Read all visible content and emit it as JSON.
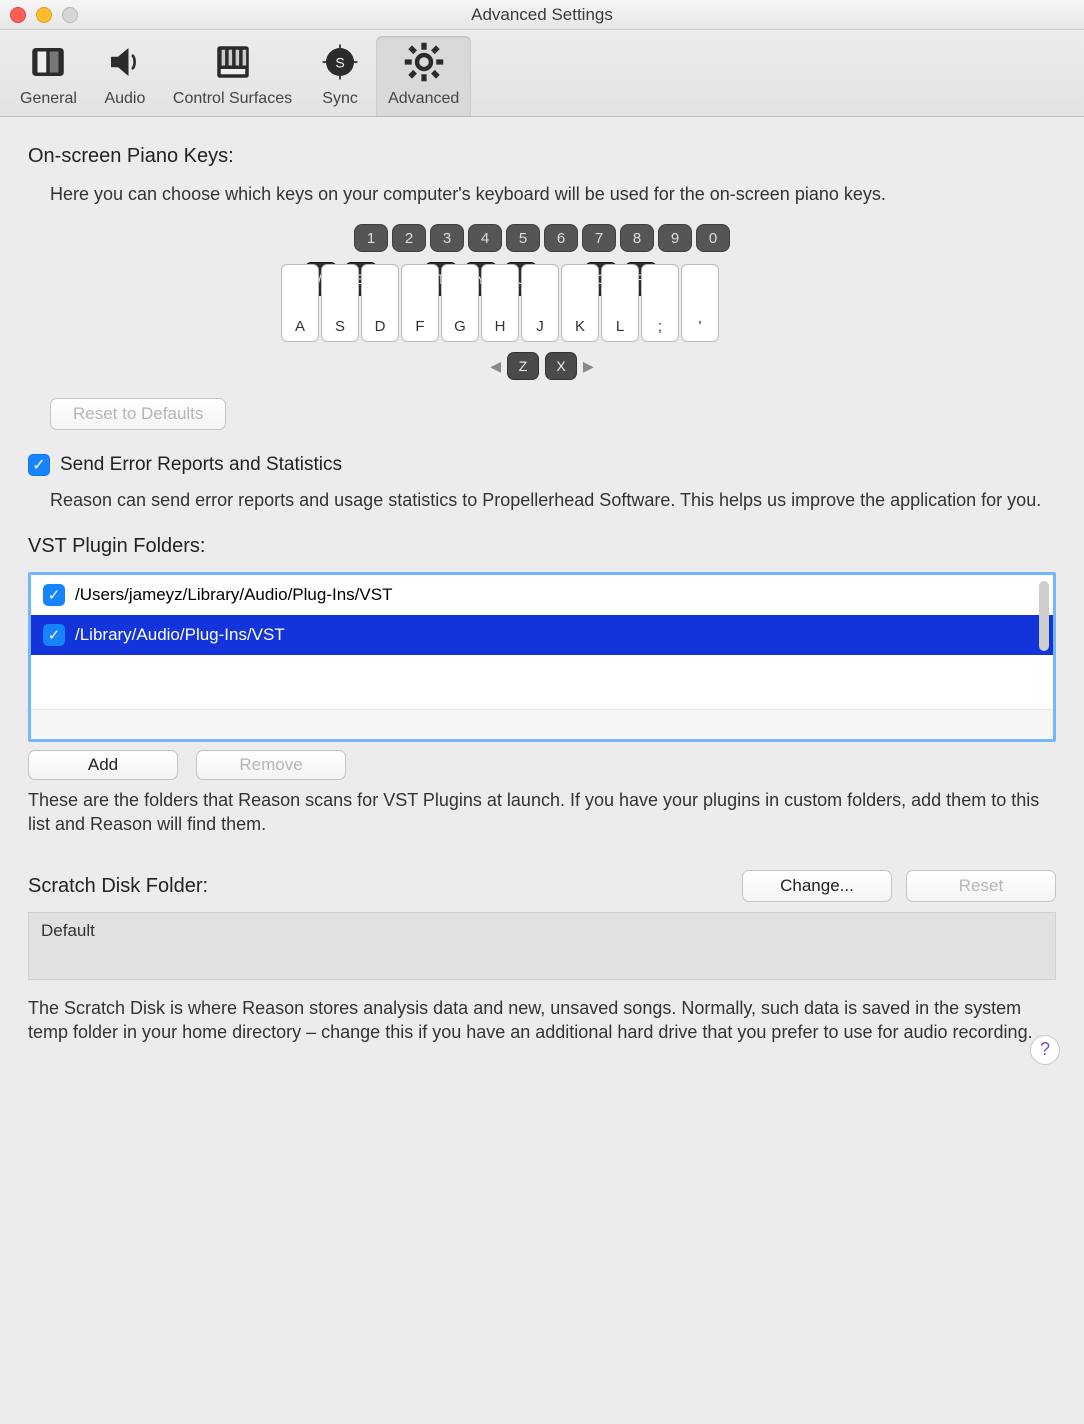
{
  "window": {
    "title": "Advanced Settings"
  },
  "tabs": {
    "general": "General",
    "audio": "Audio",
    "surfaces": "Control Surfaces",
    "sync": "Sync",
    "advanced": "Advanced"
  },
  "piano": {
    "heading": "On-screen Piano Keys:",
    "help": "Here you can choose which keys on your computer's keyboard will be used for the on-screen piano keys.",
    "num_row": [
      "1",
      "2",
      "3",
      "4",
      "5",
      "6",
      "7",
      "8",
      "9",
      "0"
    ],
    "black_keys": [
      {
        "label": "W",
        "slot": 0
      },
      {
        "label": "E",
        "slot": 1
      },
      {
        "label": "T",
        "slot": 3
      },
      {
        "label": "Y",
        "slot": 4
      },
      {
        "label": "U",
        "slot": 5
      },
      {
        "label": "O",
        "slot": 7
      },
      {
        "label": "P",
        "slot": 8
      }
    ],
    "white_keys": [
      "A",
      "S",
      "D",
      "F",
      "G",
      "H",
      "J",
      "K",
      "L",
      ";",
      "'"
    ],
    "oct_keys": [
      "Z",
      "X"
    ],
    "reset_label": "Reset to Defaults"
  },
  "error_reports": {
    "checked": true,
    "label": "Send Error Reports and Statistics",
    "help": "Reason can send error reports and usage statistics to Propellerhead Software. This helps us improve the application for you."
  },
  "vst": {
    "heading": "VST Plugin Folders:",
    "rows": [
      {
        "checked": true,
        "path": "/Users/jameyz/Library/Audio/Plug-Ins/VST",
        "selected": false
      },
      {
        "checked": true,
        "path": "/Library/Audio/Plug-Ins/VST",
        "selected": true
      }
    ],
    "add_label": "Add",
    "remove_label": "Remove",
    "help": "These are the folders that Reason scans for VST Plugins at launch. If you have your plugins in custom folders, add them to this list and Reason will find them."
  },
  "scratch": {
    "heading": "Scratch Disk Folder:",
    "change_label": "Change...",
    "reset_label": "Reset",
    "value": "Default",
    "help": "The Scratch Disk is where Reason stores analysis data and new, unsaved songs. Normally, such data is saved in the system temp folder in your home directory – change this if you have an additional hard drive that you prefer to use for audio recording."
  },
  "help_icon": "?"
}
